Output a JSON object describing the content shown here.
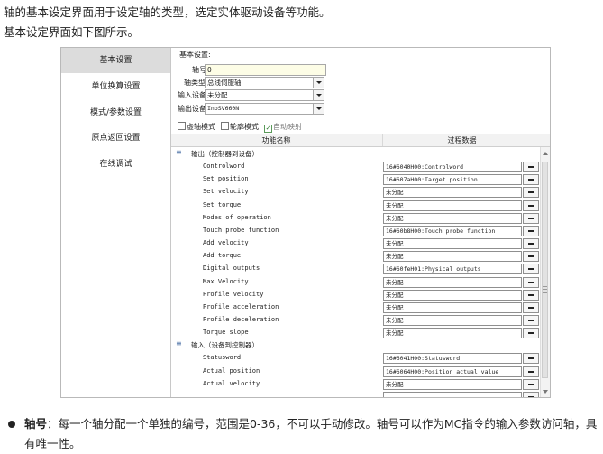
{
  "intro": {
    "line1": "轴的基本设定界面用于设定轴的类型，选定实体驱动设备等功能。",
    "line2": "基本设定界面如下图所示。"
  },
  "sidebar": {
    "items": [
      {
        "label": "基本设置",
        "active": true
      },
      {
        "label": "单位换算设置",
        "active": false
      },
      {
        "label": "模式/参数设置",
        "active": false
      },
      {
        "label": "原点返回设置",
        "active": false
      },
      {
        "label": "在线调试",
        "active": false
      }
    ]
  },
  "settings": {
    "title": "基本设置:",
    "axis_no_label": "轴号",
    "axis_no_value": "0",
    "axis_type_label": "轴类型",
    "axis_type_value": "总线伺服轴",
    "input_device_label": "输入设备",
    "input_device_value": "未分配",
    "output_device_label": "输出设备",
    "output_device_value": "InoSV660N",
    "virtual_axis_label": "虚轴模式",
    "virtual_axis_checked": false,
    "cam_mode_label": "轮廓模式",
    "cam_mode_checked": false,
    "auto_map_label": "自动映射",
    "auto_map_checked": true
  },
  "grid": {
    "col_function": "功能名称",
    "col_process_data": "过程数据",
    "groups": [
      {
        "name": "输出（控制器到设备）",
        "rows": [
          {
            "name": "Controlword",
            "value": "16#6040H00:Controlword"
          },
          {
            "name": "Set position",
            "value": "16#607aH00:Target position"
          },
          {
            "name": "Set velocity",
            "value": "未分配"
          },
          {
            "name": "Set torque",
            "value": "未分配"
          },
          {
            "name": "Modes of operation",
            "value": "未分配"
          },
          {
            "name": "Touch probe function",
            "value": "16#60b8H00:Touch probe function"
          },
          {
            "name": "Add velocity",
            "value": "未分配"
          },
          {
            "name": "Add torque",
            "value": "未分配"
          },
          {
            "name": "Digital outputs",
            "value": "16#60feH01:Physical outputs"
          },
          {
            "name": "Max Velocity",
            "value": "未分配"
          },
          {
            "name": "Profile velocity",
            "value": "未分配"
          },
          {
            "name": "Profile acceleration",
            "value": "未分配"
          },
          {
            "name": "Profile deceleration",
            "value": "未分配"
          },
          {
            "name": "Torque slope",
            "value": "未分配"
          }
        ]
      },
      {
        "name": "输入（设备到控制器）",
        "rows": [
          {
            "name": "Statusword",
            "value": "16#6041H00:Statusword"
          },
          {
            "name": "Actual position",
            "value": "16#6064H00:Position actual value"
          },
          {
            "name": "Actual velocity",
            "value": "未分配"
          },
          {
            "name": "",
            "value": ""
          }
        ]
      }
    ]
  },
  "note": {
    "term": "轴号",
    "text": "：每一个轴分配一个单独的编号，范围是0-36，不可以手动修改。轴号可以作为MC指令的输入参数访问轴，具有唯一性。"
  },
  "colors": {
    "sidebar_active": "#dcdcdc",
    "input_bg": "#fdfde6",
    "group_icon": "#4a6fa5"
  }
}
